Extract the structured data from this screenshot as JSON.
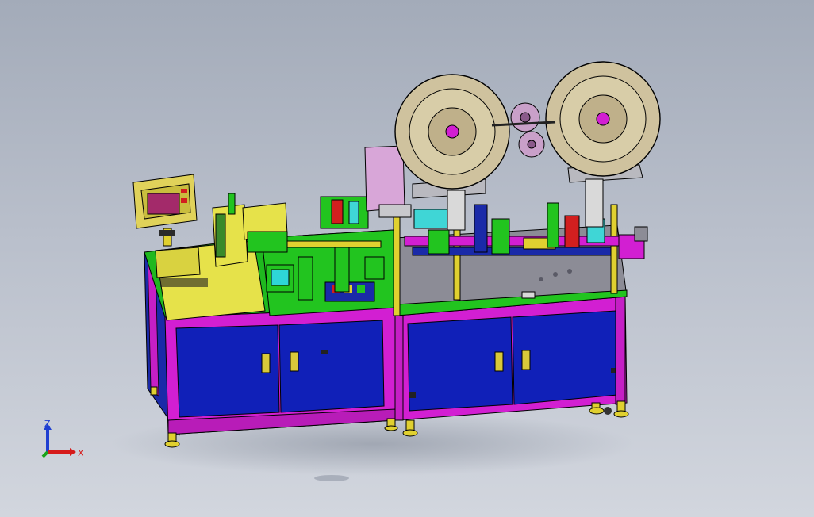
{
  "viewport": {
    "background": "#b4bac6"
  },
  "triad": {
    "z_label": "Z",
    "x_label": "X",
    "z_color": "#1f3fd1",
    "x_color": "#d61a1a",
    "y_color": "#1aa31a"
  },
  "colors": {
    "frame": "#d21fd2",
    "cabinet": "#1020b8",
    "table_green": "#22c41f",
    "base_yellow": "#e6e24a",
    "plate_grey": "#8c8c96",
    "reel_tan": "#cfc29e",
    "hmi": "#e0d25a",
    "pink": "#d8a6d8",
    "cyan": "#3fd6d6"
  }
}
